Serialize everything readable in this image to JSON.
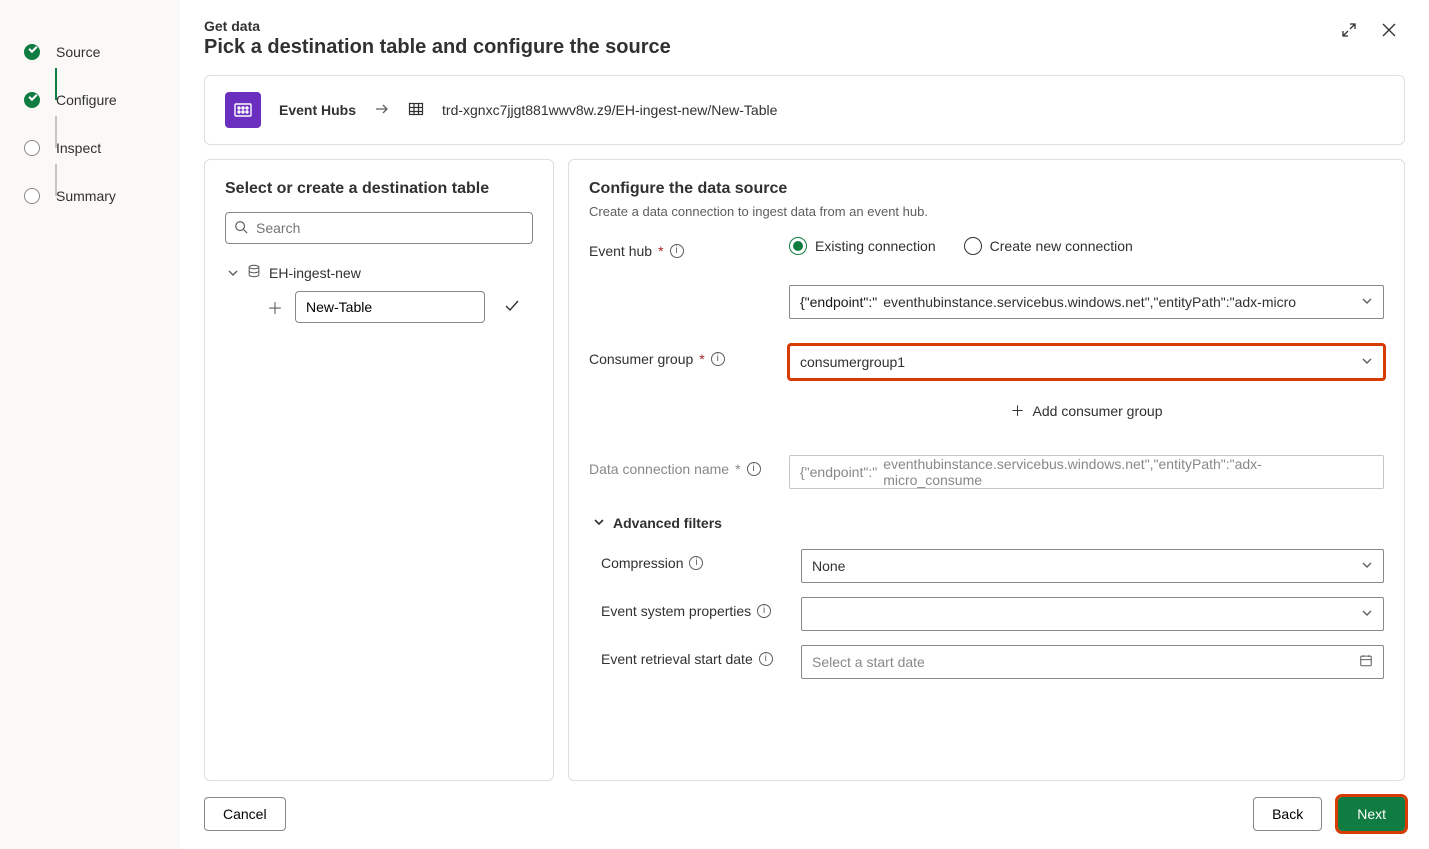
{
  "sidebar": {
    "steps": [
      {
        "label": "Source",
        "state": "done"
      },
      {
        "label": "Configure",
        "state": "active"
      },
      {
        "label": "Inspect",
        "state": "todo"
      },
      {
        "label": "Summary",
        "state": "todo"
      }
    ]
  },
  "header": {
    "pretitle": "Get data",
    "title": "Pick a destination table and configure the source"
  },
  "breadcrumb": {
    "source_label": "Event Hubs",
    "path": "trd-xgnxc7jjgt881wwv8w.z9/EH-ingest-new/New-Table"
  },
  "left_panel": {
    "title": "Select or create a destination table",
    "search_placeholder": "Search",
    "database": "EH-ingest-new",
    "new_table_value": "New-Table"
  },
  "right_panel": {
    "title": "Configure the data source",
    "subtitle": "Create a data connection to ingest data from an event hub.",
    "event_hub": {
      "label": "Event hub",
      "options": {
        "existing": "Existing connection",
        "create": "Create new connection"
      },
      "selected": "existing",
      "connection_prefix": "{\"endpoint\":\"",
      "connection_value": "eventhubinstance.servicebus.windows.net\",\"entityPath\":\"adx-micro"
    },
    "consumer_group": {
      "label": "Consumer group",
      "value": "consumergroup1",
      "add_label": "Add consumer group"
    },
    "data_connection": {
      "label": "Data connection name",
      "prefix": "{\"endpoint\":\"",
      "value": "eventhubinstance.servicebus.windows.net\",\"entityPath\":\"adx-micro_consume"
    },
    "advanced_filters": {
      "label": "Advanced filters",
      "compression": {
        "label": "Compression",
        "value": "None"
      },
      "system_props": {
        "label": "Event system properties",
        "value": ""
      },
      "start_date": {
        "label": "Event retrieval start date",
        "placeholder": "Select a start date"
      }
    }
  },
  "footer": {
    "cancel": "Cancel",
    "back": "Back",
    "next": "Next"
  }
}
